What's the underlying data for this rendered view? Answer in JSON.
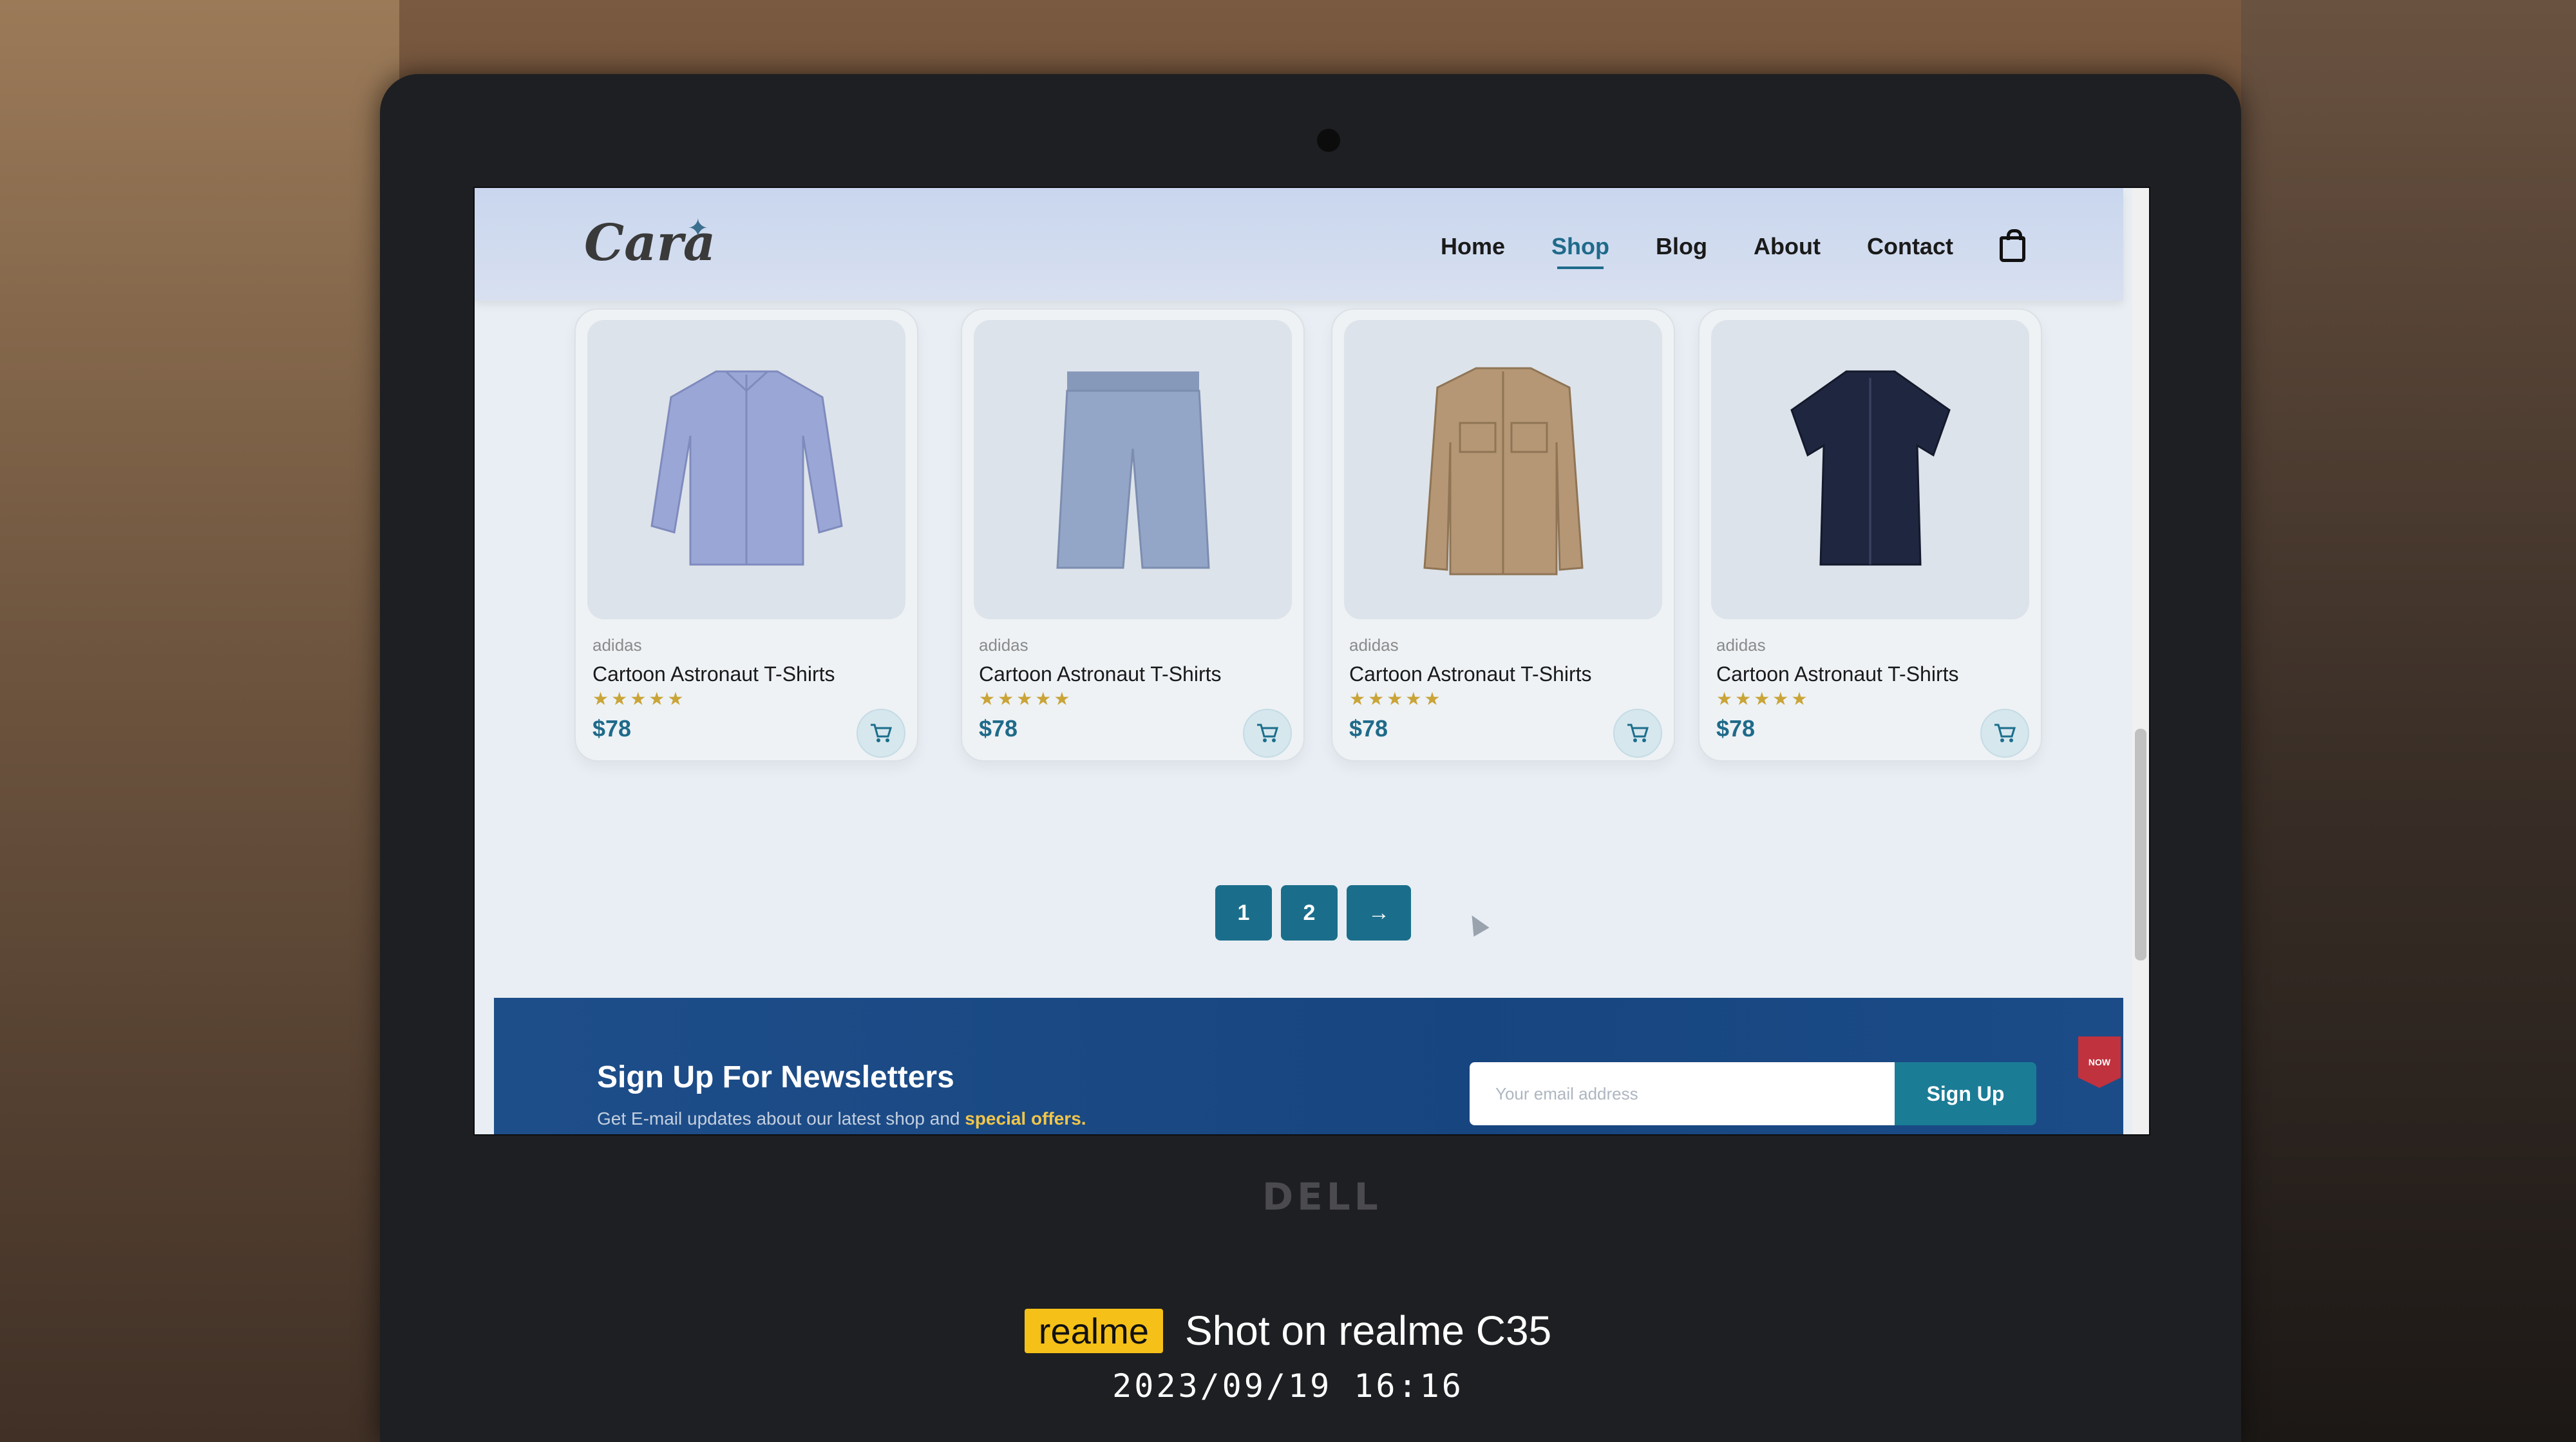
{
  "site": {
    "logo": "Cara",
    "nav": [
      {
        "label": "Home"
      },
      {
        "label": "Shop"
      },
      {
        "label": "Blog"
      },
      {
        "label": "About"
      },
      {
        "label": "Contact"
      }
    ],
    "active_nav": "Shop",
    "cart_icon": "shopping-bag-icon"
  },
  "products": [
    {
      "brand": "adidas",
      "name": "Cartoon Astronaut T-Shirts",
      "rating": 5,
      "stars": "★★★★★",
      "price": "$78",
      "image": "light blue long-sleeve shirt",
      "color": "#9aa7d6"
    },
    {
      "brand": "adidas",
      "name": "Cartoon Astronaut T-Shirts",
      "rating": 5,
      "stars": "★★★★★",
      "price": "$78",
      "image": "light blue shorts",
      "color": "#94a6c8"
    },
    {
      "brand": "adidas",
      "name": "Cartoon Astronaut T-Shirts",
      "rating": 5,
      "stars": "★★★★★",
      "price": "$78",
      "image": "khaki long-sleeve shirt",
      "color": "#b59775"
    },
    {
      "brand": "adidas",
      "name": "Cartoon Astronaut T-Shirts",
      "rating": 5,
      "stars": "★★★★★",
      "price": "$78",
      "image": "navy short-sleeve shirt",
      "color": "#1f2740"
    }
  ],
  "pagination": {
    "pages": [
      "1",
      "2"
    ],
    "next": "→"
  },
  "newsletter": {
    "title": "Sign Up For Newsletters",
    "subtitle_prefix": "Get E-mail updates about our latest shop and",
    "subtitle_accent": "special offers.",
    "email_placeholder": "Your email address",
    "button": "Sign Up",
    "badge": "NOW"
  },
  "device": {
    "brand": "DELL"
  },
  "watermark": {
    "brand": "realme",
    "text": "Shot on realme C35",
    "datetime": "2023/09/19  16:16"
  }
}
